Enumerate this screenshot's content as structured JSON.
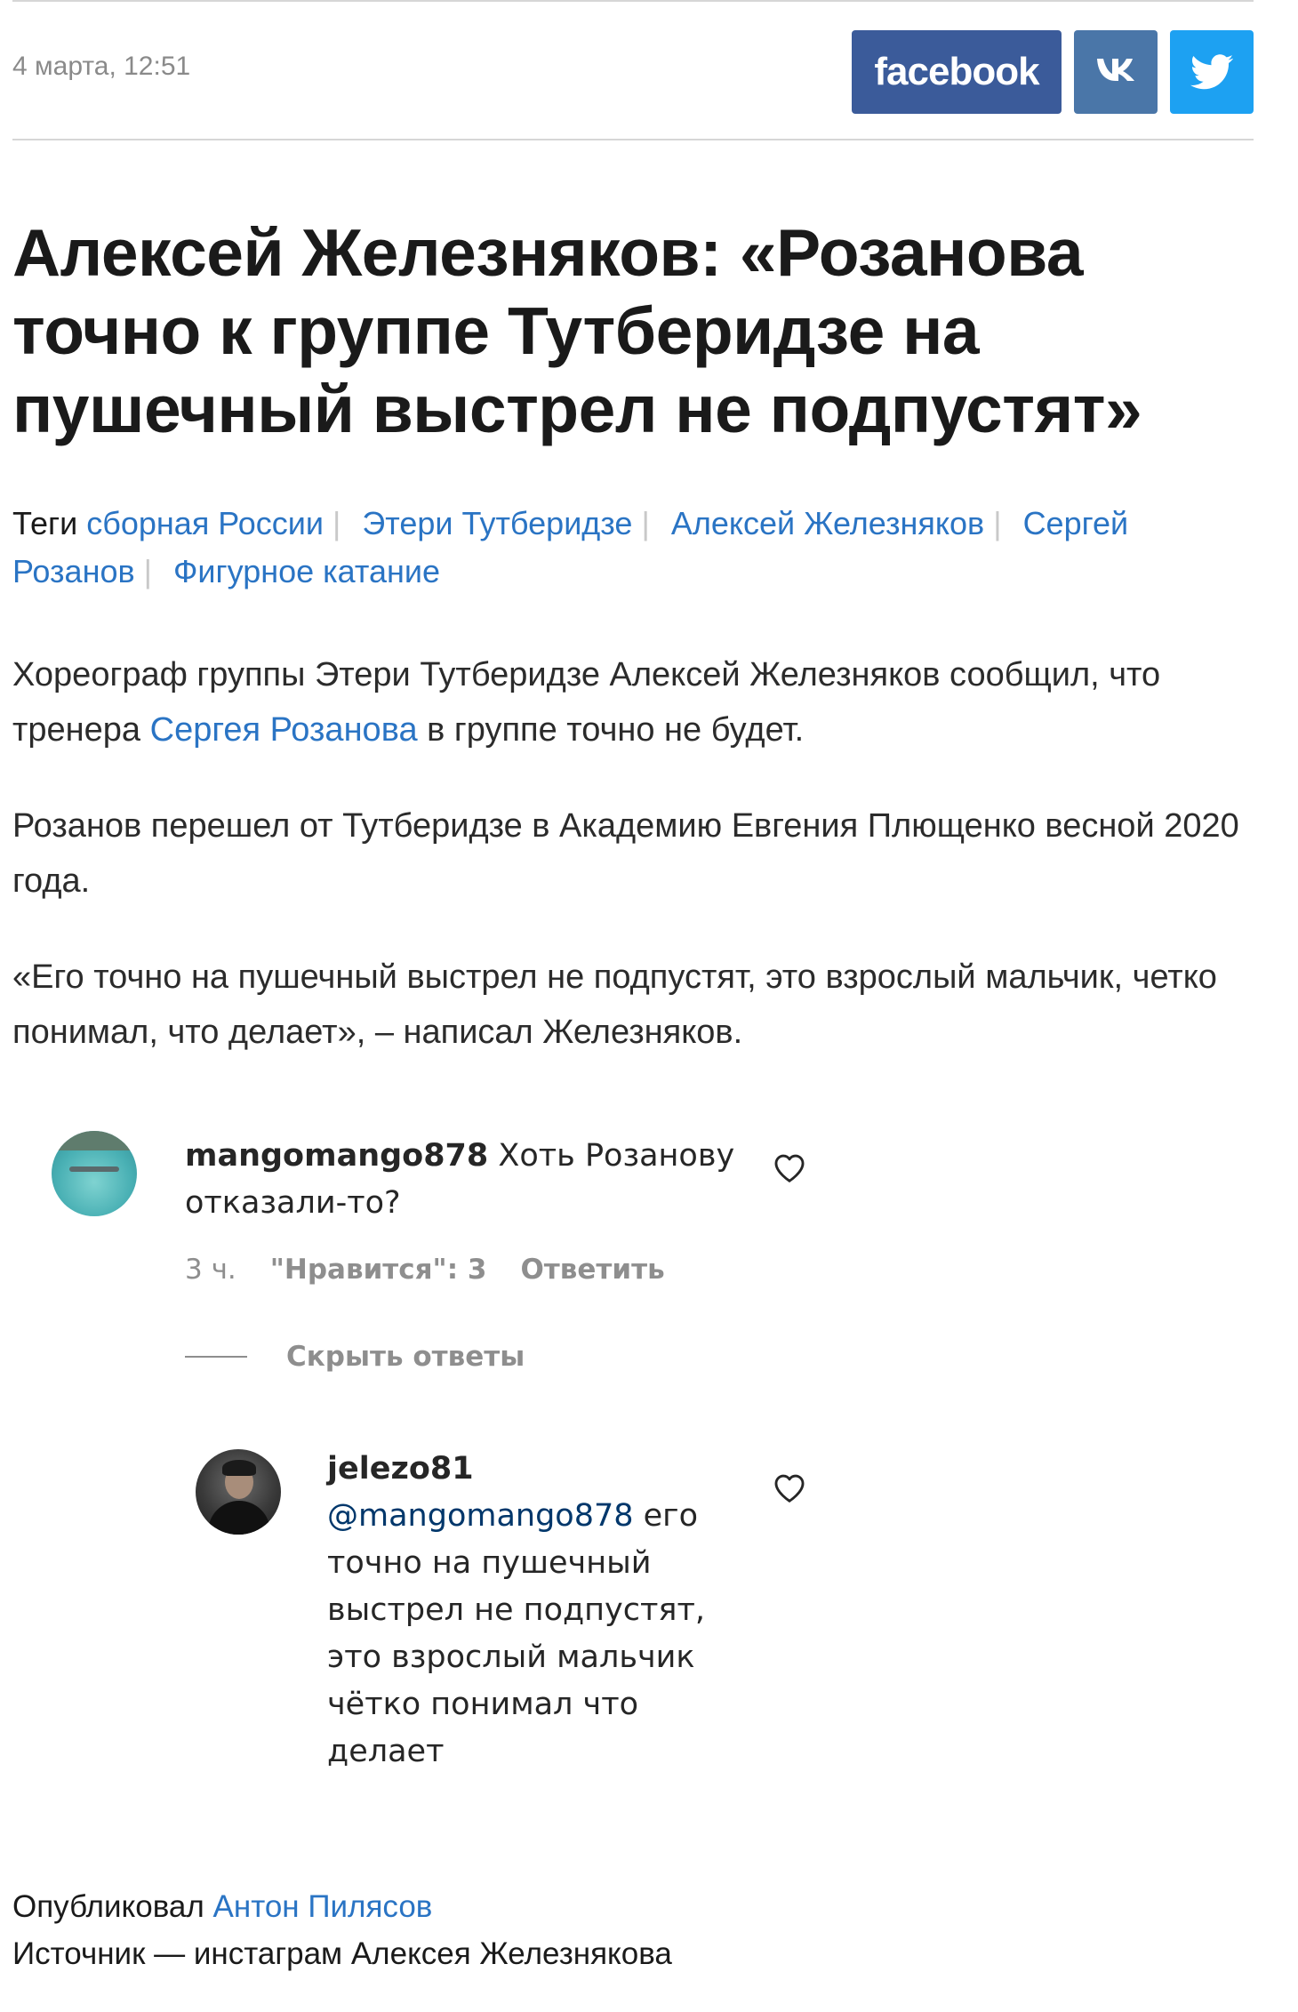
{
  "article": {
    "date": "4 марта, 12:51",
    "title": "Алексей Железняков: «Розанова точно к группе Тутберидзе на пушечный выстрел не подпустят»",
    "tags_label": "Теги",
    "tags": [
      "сборная России",
      "Этери Тутберидзе",
      "Алексей Железняков",
      "Сергей Розанов",
      "Фигурное катание"
    ],
    "paragraphs": [
      {
        "before": "Хореограф группы Этери Тутберидзе Алексей Железняков сообщил, что тренера ",
        "link": "Сергея Розанова",
        "after": " в группе точно не будет."
      },
      {
        "text": "Розанов перешел от Тутберидзе в Академию Евгения Плющенко весной 2020 года."
      },
      {
        "text": "«Его точно на пушечный выстрел не подпустят, это взрослый мальчик, четко понимал, что делает», – написал Железняков."
      }
    ]
  },
  "share": {
    "facebook_label": "facebook",
    "vk_label": "vk",
    "twitter_icon": "twitter-bird-icon",
    "colors": {
      "facebook": "#3b5b9a",
      "vk": "#4a76a8",
      "twitter": "#1da1f2"
    }
  },
  "comments": {
    "main": {
      "username": "mangomango878",
      "text": " Хоть Розанову отказали-то?",
      "time": "3 ч.",
      "likes": "\"Нравится\": 3",
      "reply_label": "Ответить"
    },
    "hide_replies_label": "Скрыть ответы",
    "reply": {
      "username": "jelezo81",
      "mention": "@mangomango878",
      "text": " его точно на пушечный выстрел не подпустят, это взрослый мальчик чётко понимал что делает"
    }
  },
  "footer": {
    "published_label": "Опубликовал ",
    "author": "Антон Пилясов",
    "source": "Источник — инстаграм Алексея Железнякова"
  },
  "colors": {
    "link": "#2a74c4",
    "text": "#1a1a1a",
    "muted": "#8a8a8a"
  }
}
